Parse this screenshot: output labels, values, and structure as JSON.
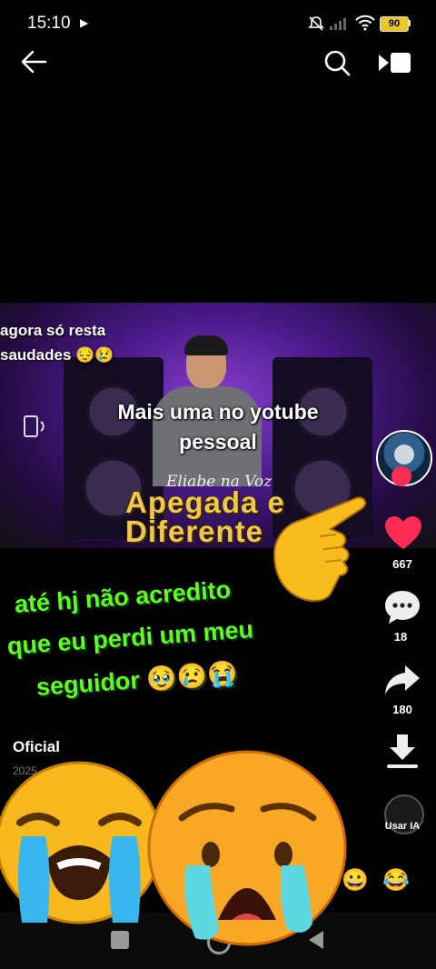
{
  "status_bar": {
    "time": "15:10",
    "battery": "90"
  },
  "video": {
    "caption_line1": "Mais uma no yotube",
    "caption_line2": "pessoal",
    "overlay_line1": "agora só resta",
    "overlay_line2": "saudades 😔😢",
    "singer": "Eliabe na Voz",
    "title_line1": "Apegada e",
    "title_line2": "Diferente"
  },
  "actions": {
    "likes": "667",
    "comments": "18",
    "shares": "180",
    "usar_ia": "Usar IA"
  },
  "overlay_text": {
    "line1": "até hj não acredito",
    "line2": "que eu perdi um meu",
    "line3": "seguidor 🥹😢😭"
  },
  "author": {
    "name": "Oficial",
    "date": "2025"
  },
  "emojis": {
    "reaction1": "😀",
    "reaction2": "😂"
  },
  "colors": {
    "like": "#fe2c55",
    "overlay_green": "#5aff1e",
    "title_gold": "#f0c84a"
  },
  "icons": [
    "back-arrow-icon",
    "search-icon",
    "cast-icon",
    "rotate-icon",
    "heart-icon",
    "comment-icon",
    "share-icon",
    "download-icon",
    "pointing-hand-icon",
    "crying-emoji-icon"
  ]
}
